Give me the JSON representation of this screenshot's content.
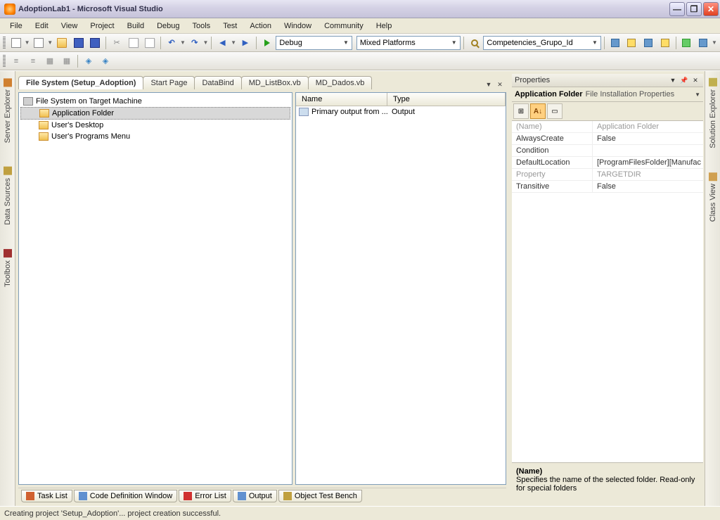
{
  "title": "AdoptionLab1 - Microsoft Visual Studio",
  "menu": [
    "File",
    "Edit",
    "View",
    "Project",
    "Build",
    "Debug",
    "Tools",
    "Test",
    "Action",
    "Window",
    "Community",
    "Help"
  ],
  "toolbar1": {
    "config_combo": "Debug",
    "platform_combo": "Mixed Platforms",
    "find_combo": "Competencies_Grupo_Id"
  },
  "doc_tabs": [
    {
      "label": "File System (Setup_Adoption)",
      "active": true
    },
    {
      "label": "Start Page",
      "active": false
    },
    {
      "label": "DataBind",
      "active": false
    },
    {
      "label": "MD_ListBox.vb",
      "active": false
    },
    {
      "label": "MD_Dados.vb",
      "active": false
    }
  ],
  "tree": {
    "root": "File System on Target Machine",
    "children": [
      {
        "label": "Application Folder",
        "selected": true
      },
      {
        "label": "User's Desktop",
        "selected": false
      },
      {
        "label": "User's Programs Menu",
        "selected": false
      }
    ]
  },
  "list": {
    "headers": [
      "Name",
      "Type"
    ],
    "rows": [
      {
        "name": "Primary output from ...",
        "type": "Output"
      }
    ]
  },
  "left_strip": [
    "Server Explorer",
    "Data Sources",
    "Toolbox"
  ],
  "right_strip": [
    "Solution Explorer",
    "Class View"
  ],
  "properties": {
    "panel_title": "Properties",
    "obj_name": "Application Folder",
    "obj_type": "File Installation Properties",
    "rows": [
      {
        "name": "(Name)",
        "value": "Application Folder",
        "gray": true
      },
      {
        "name": "AlwaysCreate",
        "value": "False",
        "gray": false
      },
      {
        "name": "Condition",
        "value": "",
        "gray": false
      },
      {
        "name": "DefaultLocation",
        "value": "[ProgramFilesFolder][Manufac",
        "gray": false
      },
      {
        "name": "Property",
        "value": "TARGETDIR",
        "gray": true
      },
      {
        "name": "Transitive",
        "value": "False",
        "gray": false
      }
    ],
    "desc_name": "(Name)",
    "desc_text": "Specifies the name of the selected folder. Read-only for special folders"
  },
  "bottom_tabs": [
    "Task List",
    "Code Definition Window",
    "Error List",
    "Output",
    "Object Test Bench"
  ],
  "status": "Creating project 'Setup_Adoption'... project creation successful."
}
